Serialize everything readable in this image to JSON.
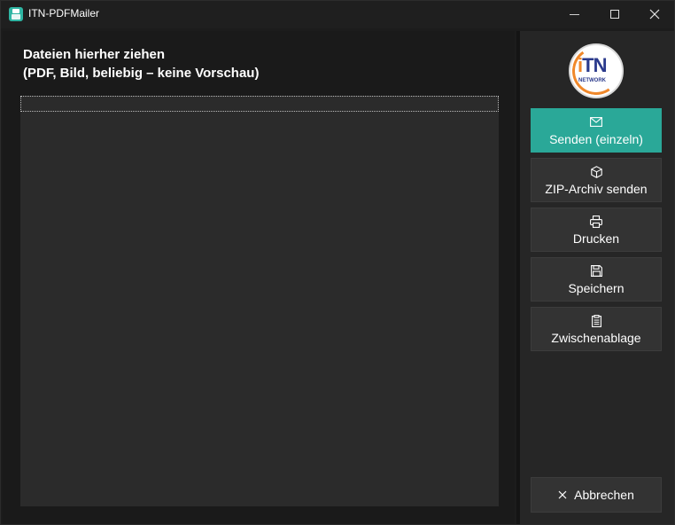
{
  "window": {
    "title": "ITN-PDFMailer"
  },
  "drop_area": {
    "heading_line1": "Dateien hierher ziehen",
    "heading_line2": "(PDF, Bild, beliebig – keine Vorschau)",
    "files": []
  },
  "sidebar": {
    "logo": {
      "text": "iTN",
      "subtext": "NETWORK"
    },
    "actions": [
      {
        "label": "Senden (einzeln)",
        "icon": "mail-icon",
        "primary": true
      },
      {
        "label": "ZIP-Archiv senden",
        "icon": "package-icon",
        "primary": false
      },
      {
        "label": "Drucken",
        "icon": "printer-icon",
        "primary": false
      },
      {
        "label": "Speichern",
        "icon": "save-icon",
        "primary": false
      },
      {
        "label": "Zwischenablage",
        "icon": "clipboard-icon",
        "primary": false
      }
    ],
    "cancel": {
      "label": "Abbrechen",
      "icon": "close-icon"
    }
  },
  "colors": {
    "accent": "#2aa898",
    "background": "#1c1c1c",
    "panel": "#2b2b2b",
    "button": "#333333"
  }
}
